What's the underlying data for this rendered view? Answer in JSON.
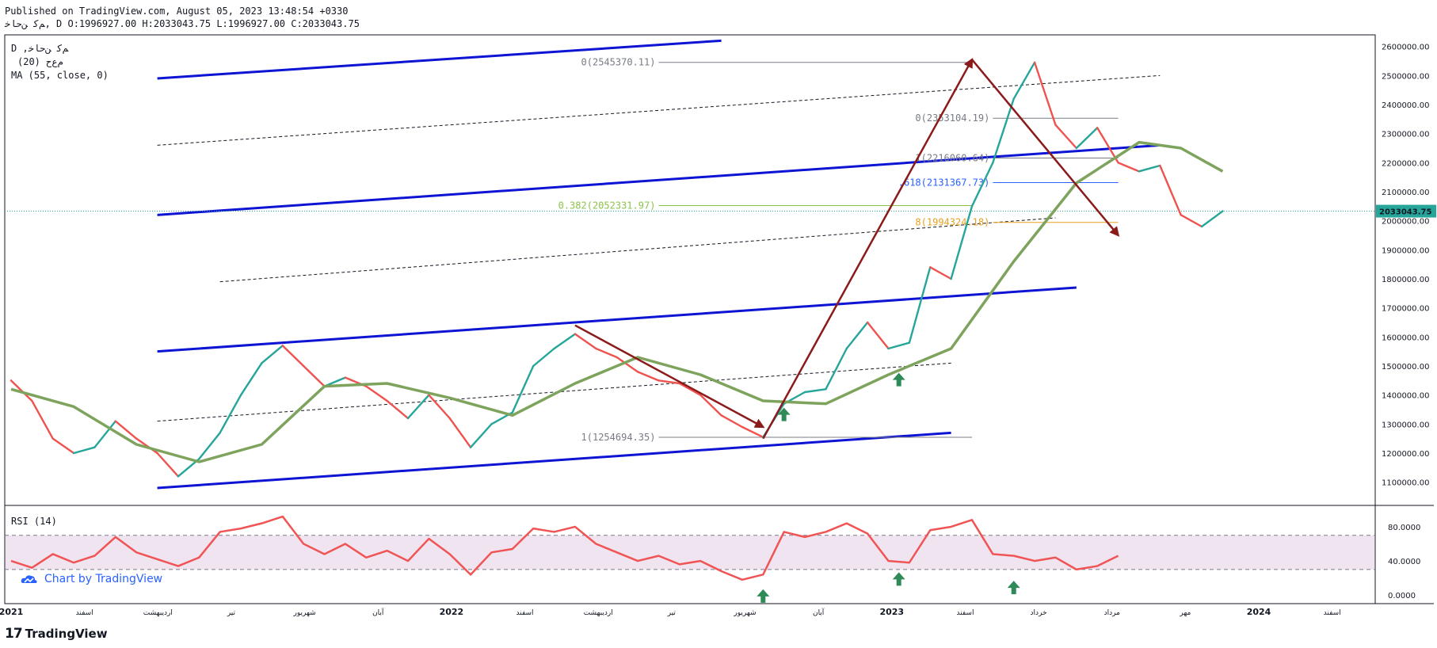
{
  "header": {
    "line1": "Published on TradingView.com, August 05, 2023 13:48:54 +0330",
    "line2": "ﻢﮐ ﻦﺣﺎﺧ, D O:1996927.00 H:2033043.75 L:1996927.00 C:2033043.75"
  },
  "legend": {
    "symbol": "D ,ﻢﮐ ﻦﺣﺎﺧ",
    "indicator1": "(20) ﻡﻉﺡ",
    "indicator2": "MA (55, close, 0)"
  },
  "rsi": {
    "label": "RSI (14)",
    "ticks": [
      "80.0000",
      "40.0000",
      "0.0000"
    ],
    "upper_band": 70,
    "lower_band": 30,
    "credit": "Chart by TradingView"
  },
  "brand": {
    "logo_text": "TradingView",
    "logo_mark": "17"
  },
  "colors": {
    "bull": "#26a69a",
    "bear": "#ef5350",
    "ma": "#7da35c",
    "channel": "#0d14d4",
    "arrow": "#8b1a1a",
    "rsi_line": "#f05454",
    "rsi_band": "#f1e4f1"
  },
  "chart_data": [
    {
      "type": "line",
      "title": "",
      "price_scale_ticks": [
        2600000,
        2500000,
        2400000,
        2300000,
        2200000,
        2100000,
        2000000,
        1900000,
        1800000,
        1700000,
        1600000,
        1500000,
        1400000,
        1300000,
        1200000,
        1100000
      ],
      "price_tick_labels": [
        "2600000.00",
        "2500000.00",
        "2400000.00",
        "2300000.00",
        "2200000.00",
        "2100000.00",
        "2000000.00",
        "1900000.00",
        "1800000.00",
        "1700000.00",
        "1600000.00",
        "1500000.00",
        "1400000.00",
        "1300000.00",
        "1200000.00",
        "1100000.00"
      ],
      "last_price": 2033043.75,
      "last_price_label": "2033043.75",
      "ylim": [
        1020000,
        2640000
      ],
      "x_axis_labels": [
        {
          "text": "2021",
          "bold": true
        },
        {
          "text": "اسفند",
          "bold": false
        },
        {
          "text": "اردیبهشت",
          "bold": false
        },
        {
          "text": "تیر",
          "bold": false
        },
        {
          "text": "شهریور",
          "bold": false
        },
        {
          "text": "آبان",
          "bold": false
        },
        {
          "text": "2022",
          "bold": true
        },
        {
          "text": "اسفند",
          "bold": false
        },
        {
          "text": "اردیبهشت",
          "bold": false
        },
        {
          "text": "تیر",
          "bold": false
        },
        {
          "text": "شهریور",
          "bold": false
        },
        {
          "text": "آبان",
          "bold": false
        },
        {
          "text": "2023",
          "bold": true
        },
        {
          "text": "اسفند",
          "bold": false
        },
        {
          "text": "خرداد",
          "bold": false
        },
        {
          "text": "مرداد",
          "bold": false
        },
        {
          "text": "مهر",
          "bold": false
        },
        {
          "text": "2024",
          "bold": true
        },
        {
          "text": "اسفند",
          "bold": false
        }
      ],
      "x_index_range": [
        0,
        130
      ],
      "price_series": [
        {
          "x": 0,
          "y": 1450000
        },
        {
          "x": 2,
          "y": 1380000
        },
        {
          "x": 4,
          "y": 1250000
        },
        {
          "x": 6,
          "y": 1200000
        },
        {
          "x": 8,
          "y": 1220000
        },
        {
          "x": 10,
          "y": 1310000
        },
        {
          "x": 12,
          "y": 1250000
        },
        {
          "x": 14,
          "y": 1200000
        },
        {
          "x": 16,
          "y": 1120000
        },
        {
          "x": 18,
          "y": 1180000
        },
        {
          "x": 20,
          "y": 1270000
        },
        {
          "x": 22,
          "y": 1400000
        },
        {
          "x": 24,
          "y": 1510000
        },
        {
          "x": 26,
          "y": 1570000
        },
        {
          "x": 28,
          "y": 1500000
        },
        {
          "x": 30,
          "y": 1430000
        },
        {
          "x": 32,
          "y": 1460000
        },
        {
          "x": 34,
          "y": 1430000
        },
        {
          "x": 36,
          "y": 1380000
        },
        {
          "x": 38,
          "y": 1320000
        },
        {
          "x": 40,
          "y": 1400000
        },
        {
          "x": 42,
          "y": 1320000
        },
        {
          "x": 44,
          "y": 1220000
        },
        {
          "x": 46,
          "y": 1300000
        },
        {
          "x": 48,
          "y": 1340000
        },
        {
          "x": 50,
          "y": 1500000
        },
        {
          "x": 52,
          "y": 1560000
        },
        {
          "x": 54,
          "y": 1610000
        },
        {
          "x": 56,
          "y": 1560000
        },
        {
          "x": 58,
          "y": 1530000
        },
        {
          "x": 60,
          "y": 1480000
        },
        {
          "x": 62,
          "y": 1450000
        },
        {
          "x": 64,
          "y": 1440000
        },
        {
          "x": 66,
          "y": 1400000
        },
        {
          "x": 68,
          "y": 1330000
        },
        {
          "x": 70,
          "y": 1290000
        },
        {
          "x": 72,
          "y": 1255000
        },
        {
          "x": 74,
          "y": 1370000
        },
        {
          "x": 76,
          "y": 1410000
        },
        {
          "x": 78,
          "y": 1420000
        },
        {
          "x": 80,
          "y": 1560000
        },
        {
          "x": 82,
          "y": 1650000
        },
        {
          "x": 84,
          "y": 1560000
        },
        {
          "x": 86,
          "y": 1580000
        },
        {
          "x": 88,
          "y": 1840000
        },
        {
          "x": 90,
          "y": 1800000
        },
        {
          "x": 92,
          "y": 2050000
        },
        {
          "x": 94,
          "y": 2200000
        },
        {
          "x": 96,
          "y": 2420000
        },
        {
          "x": 98,
          "y": 2545000
        },
        {
          "x": 100,
          "y": 2330000
        },
        {
          "x": 102,
          "y": 2250000
        },
        {
          "x": 104,
          "y": 2320000
        },
        {
          "x": 106,
          "y": 2200000
        },
        {
          "x": 108,
          "y": 2170000
        },
        {
          "x": 110,
          "y": 2190000
        },
        {
          "x": 112,
          "y": 2020000
        },
        {
          "x": 114,
          "y": 1980000
        },
        {
          "x": 116,
          "y": 2033000
        }
      ],
      "ma_series": [
        {
          "x": 0,
          "y": 1420000
        },
        {
          "x": 6,
          "y": 1360000
        },
        {
          "x": 12,
          "y": 1230000
        },
        {
          "x": 18,
          "y": 1170000
        },
        {
          "x": 24,
          "y": 1230000
        },
        {
          "x": 30,
          "y": 1430000
        },
        {
          "x": 36,
          "y": 1440000
        },
        {
          "x": 42,
          "y": 1390000
        },
        {
          "x": 48,
          "y": 1330000
        },
        {
          "x": 54,
          "y": 1440000
        },
        {
          "x": 60,
          "y": 1530000
        },
        {
          "x": 66,
          "y": 1470000
        },
        {
          "x": 72,
          "y": 1380000
        },
        {
          "x": 78,
          "y": 1370000
        },
        {
          "x": 84,
          "y": 1470000
        },
        {
          "x": 90,
          "y": 1560000
        },
        {
          "x": 96,
          "y": 1860000
        },
        {
          "x": 102,
          "y": 2130000
        },
        {
          "x": 108,
          "y": 2270000
        },
        {
          "x": 112,
          "y": 2250000
        },
        {
          "x": 116,
          "y": 2170000
        }
      ],
      "fib_levels": [
        {
          "label": "0(2545370.11)",
          "value": 2545370.11,
          "color": "#787b86"
        },
        {
          "label": "0.382(2052331.97)",
          "value": 2052331.97,
          "color": "#8bc34a"
        },
        {
          "label": "1(1254694.35)",
          "value": 1254694.35,
          "color": "#787b86"
        },
        {
          "label": "0(2353104.19)",
          "value": 2353104.19,
          "color": "#787b86"
        },
        {
          "label": "1(2216060.64)",
          "value": 2216060.64,
          "color": "#787b86"
        },
        {
          "label": ".618(2131367.73)",
          "value": 2131367.73,
          "color": "#2962ff"
        },
        {
          "label": "8(1994324.18)",
          "value": 1994324.18,
          "color": "#e6a020"
        }
      ],
      "channel_lines": [
        {
          "x1": 14,
          "y1": 2490000,
          "x2": 68,
          "y2": 2620000
        },
        {
          "x1": 14,
          "y1": 2020000,
          "x2": 110,
          "y2": 2260000
        },
        {
          "x1": 14,
          "y1": 1550000,
          "x2": 102,
          "y2": 1770000
        },
        {
          "x1": 14,
          "y1": 1080000,
          "x2": 90,
          "y2": 1270000
        }
      ],
      "dashed_lines": [
        {
          "x1": 14,
          "y1": 2260000,
          "x2": 110,
          "y2": 2500000
        },
        {
          "x1": 20,
          "y1": 1790000,
          "x2": 100,
          "y2": 2010000
        },
        {
          "x1": 14,
          "y1": 1310000,
          "x2": 90,
          "y2": 1510000
        }
      ],
      "arrows": [
        {
          "x1": 54,
          "y1": 1640000,
          "x2": 72,
          "y2": 1290000
        },
        {
          "x1": 72,
          "y1": 1250000,
          "x2": 92,
          "y2": 2555000
        },
        {
          "x1": 92,
          "y1": 2555000,
          "x2": 106,
          "y2": 1950000
        }
      ],
      "up_markers": [
        {
          "x": 74,
          "y": 1370000
        },
        {
          "x": 85,
          "y": 1490000
        }
      ]
    },
    {
      "type": "line",
      "title": "",
      "ylim": [
        -10,
        105
      ],
      "x_index_range": [
        0,
        130
      ],
      "rsi_series": [
        {
          "x": 0,
          "y": 40
        },
        {
          "x": 2,
          "y": 32
        },
        {
          "x": 4,
          "y": 48
        },
        {
          "x": 6,
          "y": 38
        },
        {
          "x": 8,
          "y": 46
        },
        {
          "x": 10,
          "y": 68
        },
        {
          "x": 12,
          "y": 50
        },
        {
          "x": 14,
          "y": 42
        },
        {
          "x": 16,
          "y": 34
        },
        {
          "x": 18,
          "y": 44
        },
        {
          "x": 20,
          "y": 74
        },
        {
          "x": 22,
          "y": 78
        },
        {
          "x": 24,
          "y": 84
        },
        {
          "x": 26,
          "y": 92
        },
        {
          "x": 28,
          "y": 60
        },
        {
          "x": 30,
          "y": 48
        },
        {
          "x": 32,
          "y": 60
        },
        {
          "x": 34,
          "y": 44
        },
        {
          "x": 36,
          "y": 52
        },
        {
          "x": 38,
          "y": 40
        },
        {
          "x": 40,
          "y": 66
        },
        {
          "x": 42,
          "y": 48
        },
        {
          "x": 44,
          "y": 24
        },
        {
          "x": 46,
          "y": 50
        },
        {
          "x": 48,
          "y": 54
        },
        {
          "x": 50,
          "y": 78
        },
        {
          "x": 52,
          "y": 74
        },
        {
          "x": 54,
          "y": 80
        },
        {
          "x": 56,
          "y": 60
        },
        {
          "x": 58,
          "y": 50
        },
        {
          "x": 60,
          "y": 40
        },
        {
          "x": 62,
          "y": 46
        },
        {
          "x": 64,
          "y": 36
        },
        {
          "x": 66,
          "y": 40
        },
        {
          "x": 68,
          "y": 28
        },
        {
          "x": 70,
          "y": 18
        },
        {
          "x": 72,
          "y": 24
        },
        {
          "x": 74,
          "y": 74
        },
        {
          "x": 76,
          "y": 68
        },
        {
          "x": 78,
          "y": 74
        },
        {
          "x": 80,
          "y": 84
        },
        {
          "x": 82,
          "y": 72
        },
        {
          "x": 84,
          "y": 40
        },
        {
          "x": 86,
          "y": 38
        },
        {
          "x": 88,
          "y": 76
        },
        {
          "x": 90,
          "y": 80
        },
        {
          "x": 92,
          "y": 88
        },
        {
          "x": 94,
          "y": 48
        },
        {
          "x": 96,
          "y": 46
        },
        {
          "x": 98,
          "y": 40
        },
        {
          "x": 100,
          "y": 44
        },
        {
          "x": 102,
          "y": 30
        },
        {
          "x": 104,
          "y": 34
        },
        {
          "x": 106,
          "y": 46
        }
      ],
      "up_markers": [
        {
          "x": 72,
          "y": 4
        },
        {
          "x": 85,
          "y": 24
        },
        {
          "x": 96,
          "y": 14
        }
      ]
    }
  ]
}
